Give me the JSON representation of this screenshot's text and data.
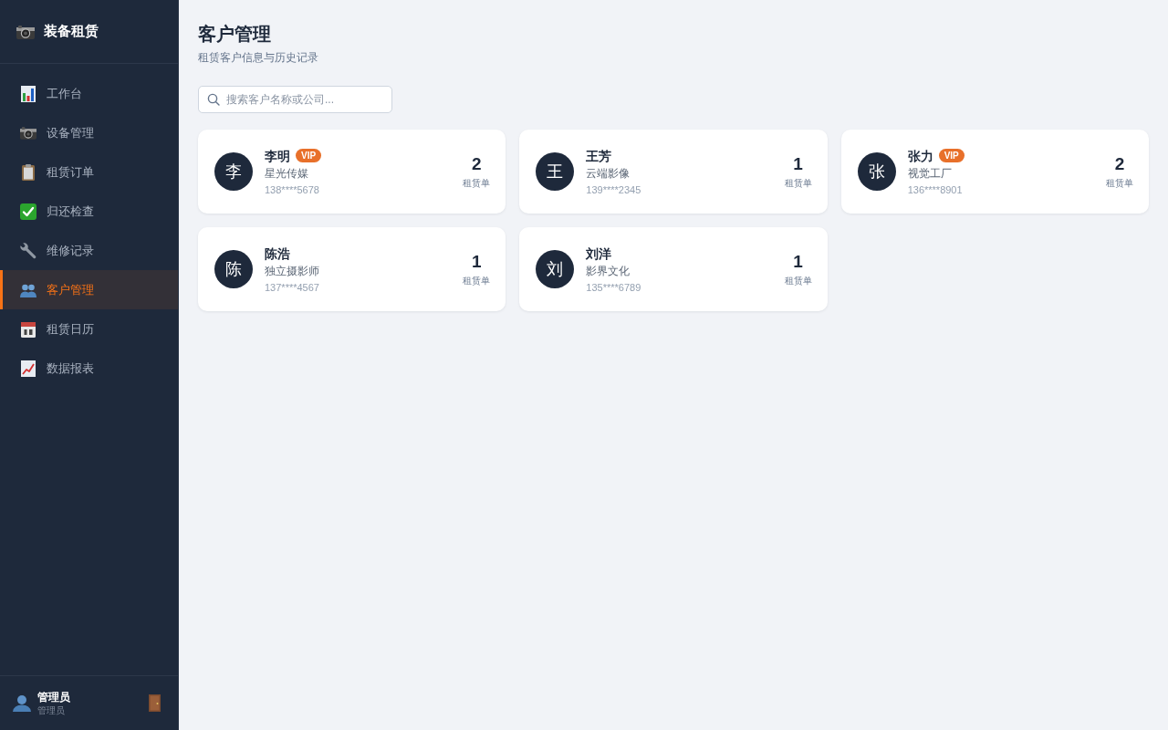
{
  "sidebar": {
    "brand": {
      "title": "装备租赁"
    },
    "items": [
      {
        "label": "工作台",
        "selected": false
      },
      {
        "label": "设备管理",
        "selected": false
      },
      {
        "label": "租赁订单",
        "selected": false
      },
      {
        "label": "归还检查",
        "selected": false
      },
      {
        "label": "维修记录",
        "selected": false
      },
      {
        "label": "客户管理",
        "selected": true
      },
      {
        "label": "租赁日历",
        "selected": false
      },
      {
        "label": "数据报表",
        "selected": false
      }
    ],
    "user": {
      "name": "管理员",
      "role": "管理员"
    }
  },
  "header": {
    "title": "客户管理",
    "subtitle": "租赁客户信息与历史记录"
  },
  "search": {
    "placeholder": "搜索客户名称或公司..."
  },
  "customers": [
    {
      "avatar": "李",
      "name": "李明",
      "badge": "VIP",
      "company": "星光传媒",
      "phone": "138****5678",
      "count": "2",
      "count_label": "租赁单"
    },
    {
      "avatar": "王",
      "name": "王芳",
      "company": "云端影像",
      "phone": "139****2345",
      "count": "1",
      "count_label": "租赁单"
    },
    {
      "avatar": "张",
      "name": "张力",
      "badge": "VIP",
      "company": "视觉工厂",
      "phone": "136****8901",
      "count": "2",
      "count_label": "租赁单"
    },
    {
      "avatar": "陈",
      "name": "陈浩",
      "company": "独立摄影师",
      "phone": "137****4567",
      "count": "1",
      "count_label": "租赁单"
    },
    {
      "avatar": "刘",
      "name": "刘洋",
      "company": "影界文化",
      "phone": "135****6789",
      "count": "1",
      "count_label": "租赁单"
    }
  ]
}
